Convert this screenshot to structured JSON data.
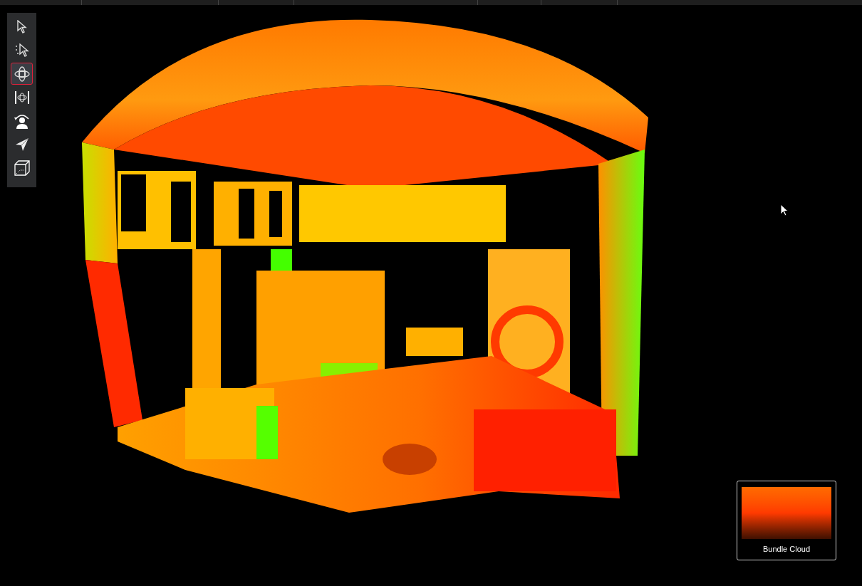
{
  "toolbar": {
    "tools": [
      {
        "kind": "select",
        "selected": false
      },
      {
        "kind": "lasso-select",
        "selected": false
      },
      {
        "kind": "orbit",
        "selected": true
      },
      {
        "kind": "pan",
        "selected": false
      },
      {
        "kind": "walk",
        "selected": false
      },
      {
        "kind": "fly",
        "selected": false
      },
      {
        "kind": "box",
        "selected": false
      }
    ]
  },
  "thumbnail": {
    "label": "Bundle Cloud"
  }
}
